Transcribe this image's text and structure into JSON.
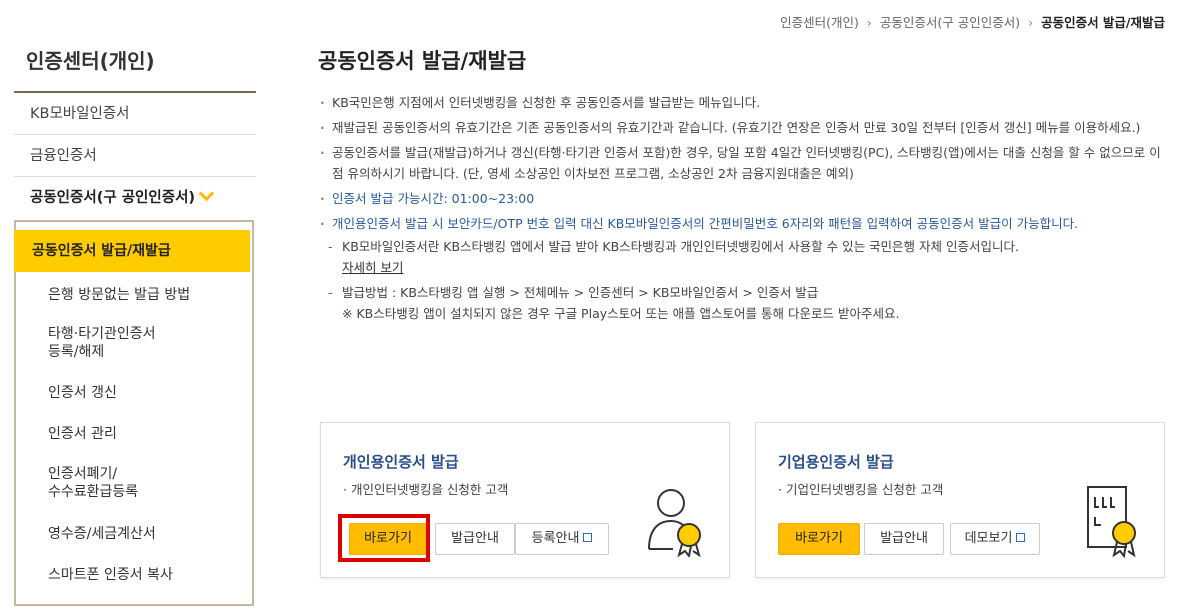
{
  "breadcrumb": {
    "items": [
      "인증센터(개인)",
      "공동인증서(구 공인인증서)"
    ],
    "current": "공동인증서 발급/재발급",
    "separator": "›"
  },
  "sidebar": {
    "title": "인증센터(개인)",
    "items": [
      {
        "label": "KB모바일인증서"
      },
      {
        "label": "금융인증서"
      },
      {
        "label": "공동인증서(구 공인인증서)"
      }
    ],
    "submenu": [
      {
        "label": "공동인증서 발급/재발급"
      },
      {
        "label": "은행 방문없는 발급 방법"
      },
      {
        "label": "타행·타기관인증서\n등록/해제"
      },
      {
        "label": "인증서 갱신"
      },
      {
        "label": "인증서 관리"
      },
      {
        "label": "인증서폐기/\n수수료환급등록"
      },
      {
        "label": "영수증/세금계산서"
      },
      {
        "label": "스마트폰 인증서 복사"
      }
    ]
  },
  "main": {
    "title": "공동인증서 발급/재발급",
    "info": [
      "KB국민은행 지점에서 인터넷뱅킹을 신청한 후 공동인증서를 발급받는 메뉴입니다.",
      "재발급된 공동인증서의 유효기간은 기존 공동인증서의 유효기간과 같습니다. (유효기간 연장은 인증서 만료 30일 전부터 [인증서 갱신] 메뉴를 이용하세요.)",
      "공동인증서를 발급(재발급)하거나 갱신(타행·타기관 인증서 포함)한 경우, 당일 포함 4일간 인터넷뱅킹(PC), 스타뱅킹(앱)에서는 대출 신청을 할 수 없으므로 이 점 유의하시기 바랍니다. (단, 영세 소상공인 이차보전 프로그램, 소상공인 2차 금융지원대출은 예외)",
      "인증서 발급 가능시간: 01:00~23:00",
      "개인용인증서 발급 시 보안카드/OTP 번호 입력 대신 KB모바일인증서의 간편비밀번호 6자리와 패턴을 입력하여 공동인증서 발급이 가능합니다."
    ],
    "sub_info_1": "KB모바일인증서란 KB스타뱅킹 앱에서 발급 받아 KB스타뱅킹과 개인인터넷뱅킹에서 사용할 수 있는 국민은행 자체 인증서입니다.",
    "detail_link": "자세히 보기",
    "sub_info_2": "발급방법 : KB스타뱅킹 앱 실행 > 전체메뉴 > 인증센터 > KB모바일인증서 > 인증서 발급",
    "sub_info_3": "※ KB스타뱅킹 앱이 설치되지 않은 경우 구글 Play스토어 또는 애플 앱스토어를 통해 다운로드 받아주세요."
  },
  "cards": {
    "personal": {
      "title": "개인용인증서 발급",
      "desc": "· 개인인터넷뱅킹을 신청한 고객",
      "btn_go": "바로가기",
      "btn_guide": "발급안내",
      "btn_register": "등록안내",
      "icon": "person-certificate-icon"
    },
    "corporate": {
      "title": "기업용인증서 발급",
      "desc": "· 기업인터넷뱅킹을 신청한 고객",
      "btn_go": "바로가기",
      "btn_guide": "발급안내",
      "btn_demo": "데모보기",
      "icon": "document-certificate-icon"
    }
  },
  "colors": {
    "accent": "#ffcc00",
    "button_primary": "#ffbc00",
    "highlight": "#e00000",
    "title_blue": "#2a4e8a",
    "info_blue": "#2a5a9e"
  }
}
